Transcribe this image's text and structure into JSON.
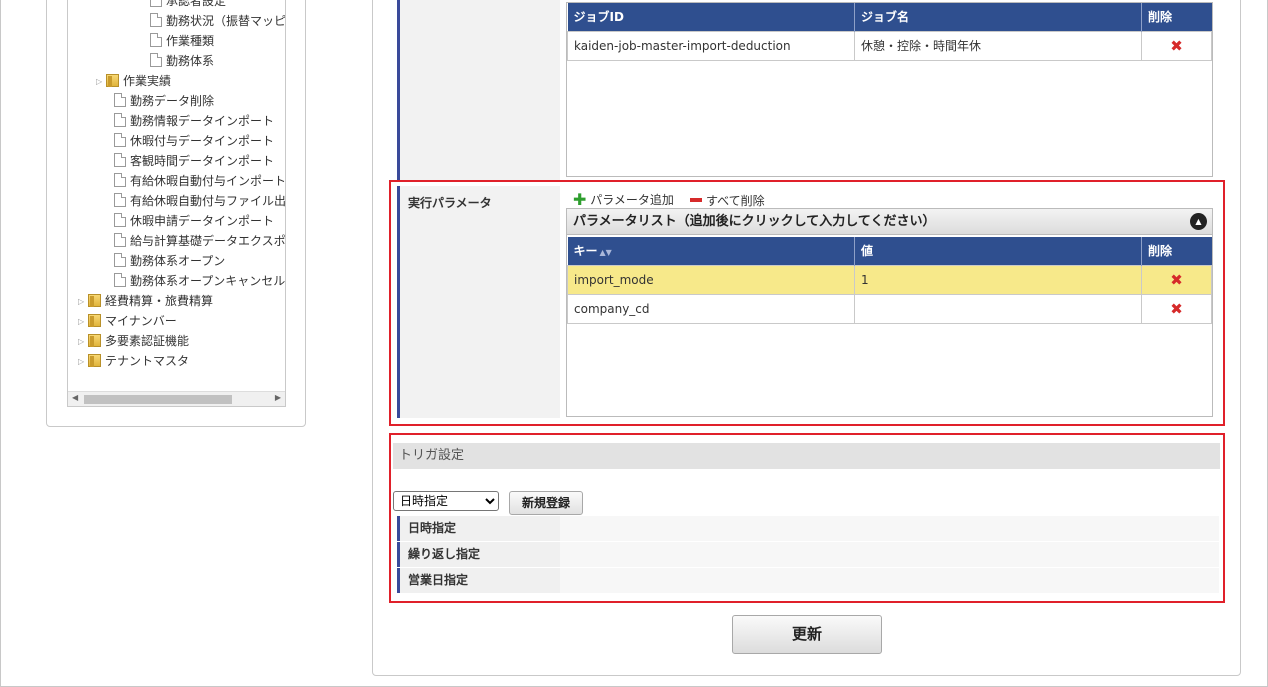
{
  "tree": {
    "items": [
      {
        "label": "承認者設定",
        "icon": "doc-icon",
        "expander": ""
      },
      {
        "label": "勤務状況（振替マッピ",
        "icon": "doc-icon",
        "expander": ""
      },
      {
        "label": "作業種類",
        "icon": "doc-icon",
        "expander": ""
      },
      {
        "label": "勤務体系",
        "icon": "doc-icon",
        "expander": ""
      },
      {
        "label": "作業実績",
        "icon": "folder-icon",
        "expander": "▷"
      },
      {
        "label": "勤務データ削除",
        "icon": "doc-icon",
        "expander": ""
      },
      {
        "label": "勤務情報データインポート",
        "icon": "doc-icon",
        "expander": ""
      },
      {
        "label": "休暇付与データインポート",
        "icon": "doc-icon",
        "expander": ""
      },
      {
        "label": "客観時間データインポート",
        "icon": "doc-icon",
        "expander": ""
      },
      {
        "label": "有給休暇自動付与インポート",
        "icon": "doc-icon",
        "expander": ""
      },
      {
        "label": "有給休暇自動付与ファイル出",
        "icon": "doc-icon",
        "expander": ""
      },
      {
        "label": "休暇申請データインポート",
        "icon": "doc-icon",
        "expander": ""
      },
      {
        "label": "給与計算基礎データエクスポ",
        "icon": "doc-icon",
        "expander": ""
      },
      {
        "label": "勤務体系オープン",
        "icon": "doc-icon",
        "expander": ""
      },
      {
        "label": "勤務体系オープンキャンセル",
        "icon": "doc-icon",
        "expander": ""
      },
      {
        "label": "経費精算・旅費精算",
        "icon": "folder-icon",
        "expander": "▷"
      },
      {
        "label": "マイナンバー",
        "icon": "folder-icon",
        "expander": "▷"
      },
      {
        "label": "多要素認証機能",
        "icon": "folder-icon",
        "expander": "▷"
      },
      {
        "label": "テナントマスタ",
        "icon": "folder-icon",
        "expander": "▷"
      }
    ]
  },
  "job_table": {
    "headers": {
      "job_id": "ジョブID",
      "job_name": "ジョブ名",
      "delete": "削除"
    },
    "rows": [
      {
        "job_id": "kaiden-job-master-import-deduction",
        "job_name": "休憩・控除・時間年休"
      }
    ]
  },
  "params": {
    "section_label": "実行パラメータ",
    "add_label": "パラメータ追加",
    "remove_all_label": "すべて削除",
    "list_caption": "パラメータリスト（追加後にクリックして入力してください）",
    "headers": {
      "key": "キー",
      "value": "値",
      "delete": "削除"
    },
    "rows": [
      {
        "key": "import_mode",
        "value": "1",
        "selected": true
      },
      {
        "key": "company_cd",
        "value": "",
        "selected": false
      }
    ]
  },
  "trigger": {
    "section_title": "トリガ設定",
    "select_value": "日時指定",
    "new_button": "新規登録",
    "rows": [
      "日時指定",
      "繰り返し指定",
      "営業日指定"
    ]
  },
  "update_button": "更新",
  "colors": {
    "header_blue": "#2f4f8f",
    "highlight_red": "#e0202a",
    "selected_row": "#f7e98a",
    "delete_red": "#d62a2a"
  }
}
